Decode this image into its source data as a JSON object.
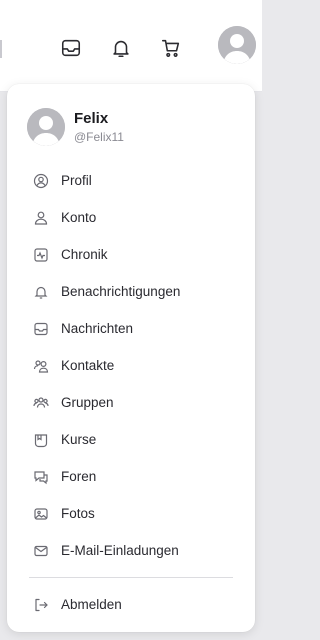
{
  "topbar": {
    "icons": [
      "inbox-icon",
      "bell-icon",
      "cart-icon"
    ]
  },
  "profile": {
    "name": "Felix",
    "handle": "@Felix11"
  },
  "menu": {
    "items": [
      {
        "label": "Profil",
        "icon": "user-circle-icon"
      },
      {
        "label": "Konto",
        "icon": "user-icon"
      },
      {
        "label": "Chronik",
        "icon": "activity-icon"
      },
      {
        "label": "Benachrichtigungen",
        "icon": "bell-icon"
      },
      {
        "label": "Nachrichten",
        "icon": "inbox-icon"
      },
      {
        "label": "Kontakte",
        "icon": "users-icon"
      },
      {
        "label": "Gruppen",
        "icon": "group-icon"
      },
      {
        "label": "Kurse",
        "icon": "course-icon"
      },
      {
        "label": "Foren",
        "icon": "forum-icon"
      },
      {
        "label": "Fotos",
        "icon": "photos-icon"
      },
      {
        "label": "E-Mail-Einladungen",
        "icon": "mail-icon"
      }
    ],
    "logout": {
      "label": "Abmelden",
      "icon": "logout-icon"
    }
  }
}
